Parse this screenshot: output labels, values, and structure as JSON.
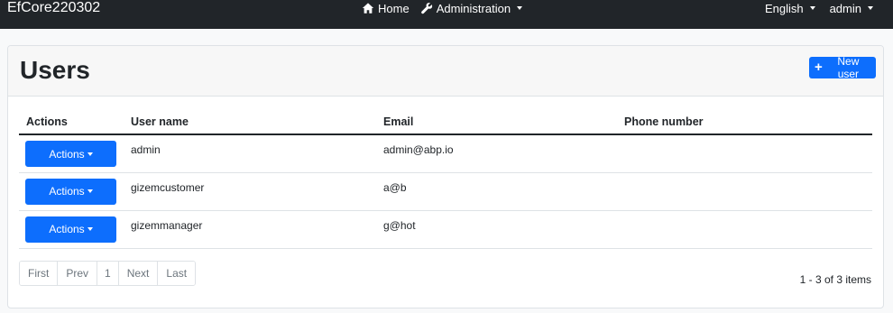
{
  "navbar": {
    "brand": "EfCore220302",
    "home": "Home",
    "administration": "Administration",
    "language": "English",
    "user": "admin"
  },
  "page": {
    "title": "Users",
    "new_user": "New user"
  },
  "table": {
    "headers": [
      "Actions",
      "User name",
      "Email",
      "Phone number"
    ],
    "rows": [
      {
        "actions": "Actions",
        "username": "admin",
        "email": "admin@abp.io",
        "phone": ""
      },
      {
        "actions": "Actions",
        "username": "gizemcustomer",
        "email": "a@b",
        "phone": ""
      },
      {
        "actions": "Actions",
        "username": "gizemmanager",
        "email": "g@hot",
        "phone": ""
      }
    ]
  },
  "pagination": {
    "first": "First",
    "prev": "Prev",
    "current": "1",
    "next": "Next",
    "last": "Last",
    "summary": "1 - 3 of 3 items"
  },
  "colors": {
    "navbar_bg": "#212529",
    "primary": "#0d6efd",
    "page_bg": "#f8f9fa"
  },
  "icons": {
    "home": "home-icon",
    "administration": "wrench-icon",
    "new_user": "plus-icon"
  }
}
